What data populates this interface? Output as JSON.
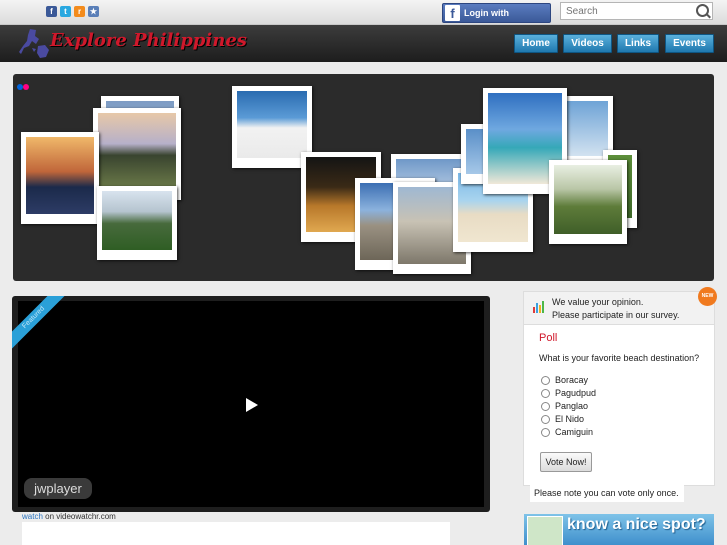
{
  "topbar": {
    "social": [
      "f",
      "t",
      "r",
      "★"
    ],
    "login_label": "Login with Facebook",
    "search_placeholder": "Search"
  },
  "header": {
    "logo": "Explore Philippines",
    "nav": [
      "Home",
      "Videos",
      "Links",
      "Events"
    ]
  },
  "video": {
    "ribbon": "Featured",
    "player_logo": "jwplayer",
    "credit_link": "watch",
    "credit_rest": " on videowatchr.com"
  },
  "poll": {
    "header_line1": "We value your opinion.",
    "header_line2": "Please participate in our survey.",
    "badge": "NEW",
    "title": "Poll",
    "question": "What is your favorite beach destination?",
    "options": [
      "Boracay",
      "Pagudpud",
      "Panglao",
      "El Nido",
      "Camiguin"
    ],
    "vote_label": "Vote Now!",
    "note": "Please note you can vote only once."
  },
  "promo": {
    "text": "know a nice spot?"
  },
  "colors": {
    "brand_red": "#d0182b",
    "nav_blue": "#2a8ac4",
    "facebook_blue": "#3b5998"
  }
}
